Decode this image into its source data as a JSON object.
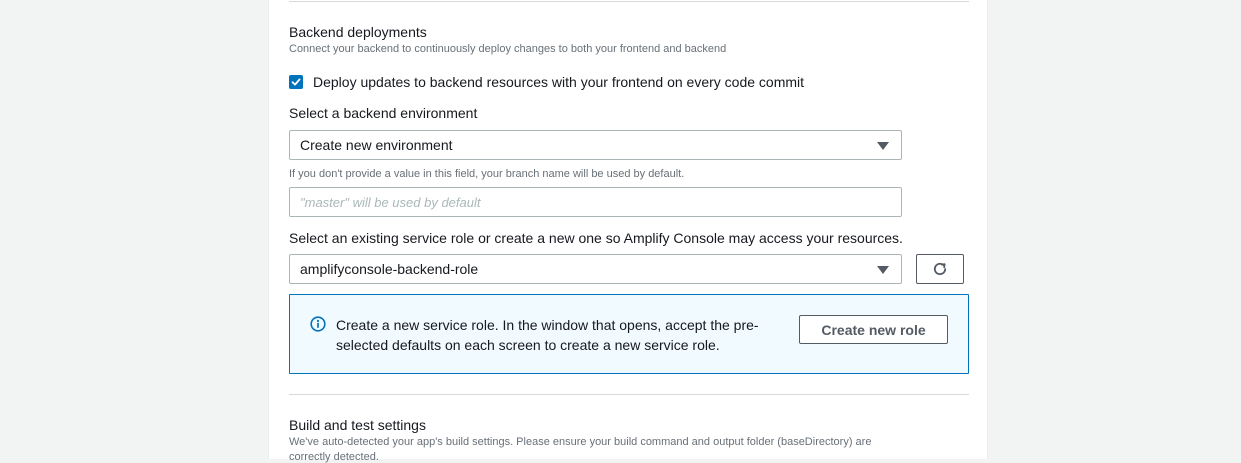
{
  "backend": {
    "title": "Backend deployments",
    "description": "Connect your backend to continuously deploy changes to both your frontend and backend",
    "checkbox_label": "Deploy updates to backend resources with your frontend on every code commit",
    "checkbox_checked": true,
    "env_label": "Select a backend environment",
    "env_selected": "Create new environment",
    "env_hint": "If you don't provide a value in this field, your branch name will be used by default.",
    "env_name_placeholder": "\"master\" will be used by default",
    "role_label": "Select an existing service role or create a new one so Amplify Console may access your resources.",
    "role_selected": "amplifyconsole-backend-role",
    "info_line1": "Create a new service role. In the window that opens, accept the pre-",
    "info_line2": "selected defaults on each screen to create a new service role.",
    "create_role_label": "Create new role"
  },
  "build": {
    "title": "Build and test settings",
    "description_line1": "We've auto-detected your app's build settings. Please ensure your build command and output folder (baseDirectory) are",
    "description_line2": "correctly detected."
  },
  "icons": {
    "checkmark": "check-icon",
    "dropdown": "caret-down-icon",
    "refresh": "refresh-icon",
    "info": "info-icon"
  },
  "colors": {
    "accent": "#0073bb",
    "info_bg": "#f1faff",
    "page_bg": "#f2f3f3",
    "muted_text": "#687078"
  }
}
